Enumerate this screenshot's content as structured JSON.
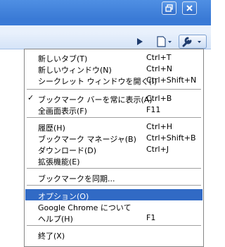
{
  "window": {
    "restore_icon": "restore-icon",
    "close_icon": "close-icon"
  },
  "toolbar": {
    "go_icon": "play-icon",
    "page_icon": "page-icon",
    "wrench_icon": "wrench-icon"
  },
  "menu": {
    "new_tab": {
      "label": "新しいタブ(T)",
      "shortcut": "Ctrl+T"
    },
    "new_window": {
      "label": "新しいウィンドウ(N)",
      "shortcut": "Ctrl+N"
    },
    "incognito": {
      "label": "シークレット ウィンドウを開く(I)",
      "shortcut": "Ctrl+Shift+N"
    },
    "bookmark_bar": {
      "label": "ブックマーク バーを常に表示(A)",
      "shortcut": "Ctrl+B",
      "check": "✓"
    },
    "fullscreen": {
      "label": "全画面表示(F)",
      "shortcut": "F11"
    },
    "history": {
      "label": "履歴(H)",
      "shortcut": "Ctrl+H"
    },
    "bookmark_manager": {
      "label": "ブックマーク マネージャ(B)",
      "shortcut": "Ctrl+Shift+B"
    },
    "downloads": {
      "label": "ダウンロード(D)",
      "shortcut": "Ctrl+J"
    },
    "extensions": {
      "label": "拡張機能(E)"
    },
    "sync": {
      "label": "ブックマークを同期..."
    },
    "options": {
      "label": "オプション(O)"
    },
    "about": {
      "label": "Google Chrome について"
    },
    "help": {
      "label": "ヘルプ(H)",
      "shortcut": "F1"
    },
    "exit": {
      "label": "終了(X)"
    }
  },
  "colors": {
    "selection": "#316ac5",
    "titlebar": "#3b7bd6"
  }
}
